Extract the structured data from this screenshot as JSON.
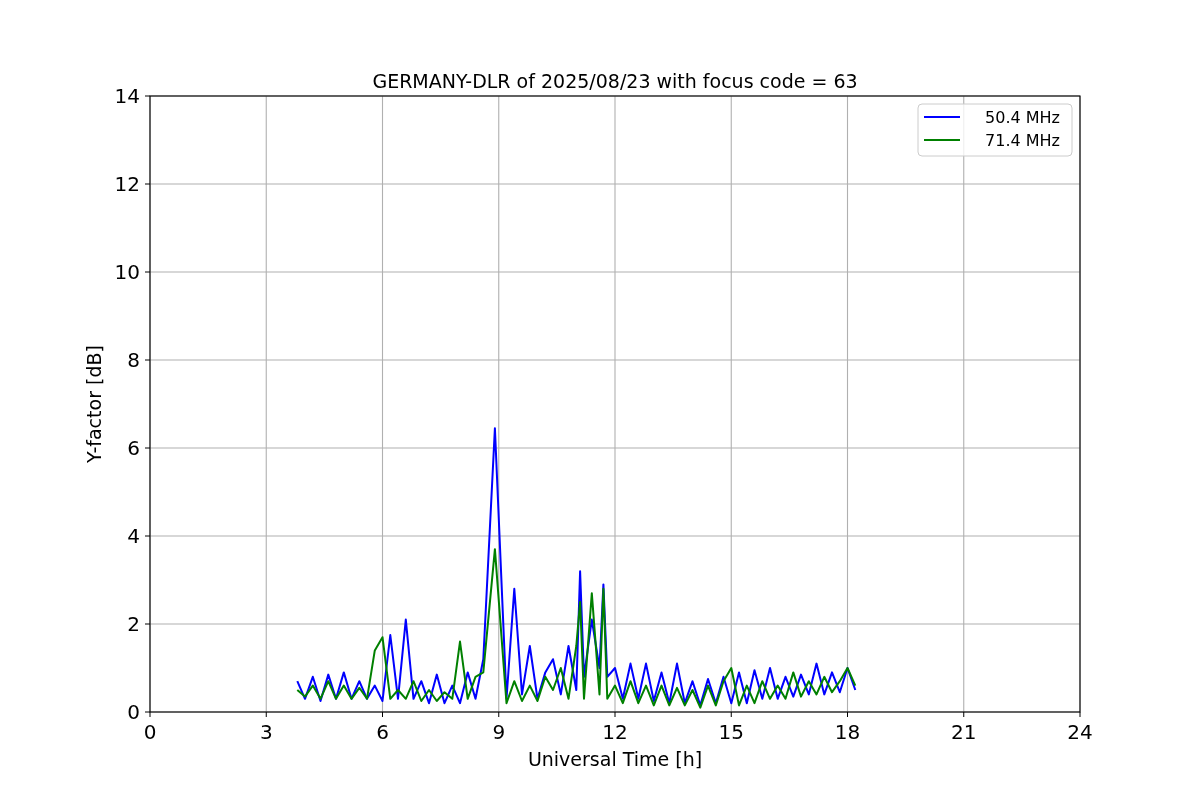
{
  "chart_data": {
    "type": "line",
    "title": "GERMANY-DLR of 2025/08/23 with focus code = 63",
    "xlabel": "Universal Time [h]",
    "ylabel": "Y-factor [dB]",
    "xlim": [
      0,
      24
    ],
    "ylim": [
      0,
      14
    ],
    "xticks": [
      0,
      3,
      6,
      9,
      12,
      15,
      18,
      21,
      24
    ],
    "yticks": [
      0,
      2,
      4,
      6,
      8,
      10,
      12,
      14
    ],
    "grid": true,
    "legend": true,
    "x": [
      3.8,
      4.0,
      4.2,
      4.4,
      4.6,
      4.8,
      5.0,
      5.2,
      5.4,
      5.6,
      5.8,
      6.0,
      6.2,
      6.4,
      6.6,
      6.8,
      7.0,
      7.2,
      7.4,
      7.6,
      7.8,
      8.0,
      8.2,
      8.4,
      8.6,
      8.9,
      9.2,
      9.4,
      9.6,
      9.8,
      10.0,
      10.2,
      10.4,
      10.6,
      10.8,
      11.0,
      11.1,
      11.2,
      11.4,
      11.6,
      11.7,
      11.8,
      12.0,
      12.2,
      12.4,
      12.6,
      12.8,
      13.0,
      13.2,
      13.4,
      13.6,
      13.8,
      14.0,
      14.2,
      14.4,
      14.6,
      14.8,
      15.0,
      15.2,
      15.4,
      15.6,
      15.8,
      16.0,
      16.2,
      16.4,
      16.6,
      16.8,
      17.0,
      17.2,
      17.4,
      17.6,
      17.8,
      18.0,
      18.2
    ],
    "series": [
      {
        "name": "50.4 MHz",
        "color": "#0000ff",
        "values": [
          0.7,
          0.3,
          0.8,
          0.25,
          0.85,
          0.3,
          0.9,
          0.3,
          0.7,
          0.3,
          0.6,
          0.25,
          1.75,
          0.3,
          2.1,
          0.3,
          0.7,
          0.2,
          0.85,
          0.2,
          0.6,
          0.2,
          0.9,
          0.3,
          1.2,
          6.45,
          0.3,
          2.8,
          0.4,
          1.5,
          0.3,
          0.9,
          1.2,
          0.4,
          1.5,
          0.5,
          3.2,
          0.8,
          2.1,
          1.0,
          2.9,
          0.8,
          1.0,
          0.3,
          1.1,
          0.3,
          1.1,
          0.25,
          0.9,
          0.2,
          1.1,
          0.2,
          0.7,
          0.15,
          0.75,
          0.2,
          0.8,
          0.2,
          0.9,
          0.2,
          0.95,
          0.3,
          1.0,
          0.3,
          0.8,
          0.35,
          0.85,
          0.4,
          1.1,
          0.4,
          0.9,
          0.45,
          1.0,
          0.5
        ]
      },
      {
        "name": "71.4 MHz",
        "color": "#008000",
        "values": [
          0.5,
          0.35,
          0.6,
          0.3,
          0.7,
          0.3,
          0.6,
          0.3,
          0.55,
          0.3,
          1.4,
          1.7,
          0.3,
          0.5,
          0.3,
          0.7,
          0.25,
          0.5,
          0.25,
          0.45,
          0.3,
          1.6,
          0.3,
          0.8,
          0.9,
          3.7,
          0.2,
          0.7,
          0.25,
          0.6,
          0.25,
          0.8,
          0.5,
          1.0,
          0.3,
          1.5,
          2.5,
          0.3,
          2.7,
          0.4,
          2.8,
          0.3,
          0.6,
          0.2,
          0.7,
          0.2,
          0.6,
          0.15,
          0.6,
          0.15,
          0.55,
          0.15,
          0.5,
          0.1,
          0.6,
          0.15,
          0.7,
          1.0,
          0.15,
          0.6,
          0.2,
          0.7,
          0.3,
          0.6,
          0.3,
          0.9,
          0.35,
          0.7,
          0.4,
          0.8,
          0.45,
          0.7,
          1.0,
          0.6
        ]
      }
    ]
  }
}
